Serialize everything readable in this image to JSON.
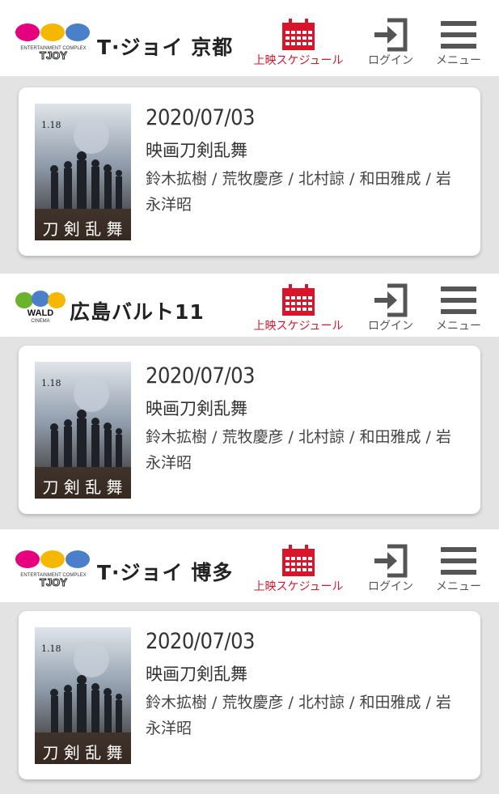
{
  "nav": {
    "schedule_label": "上映スケジュール",
    "login_label": "ログイン",
    "menu_label": "メニュー"
  },
  "brand_colors": {
    "accent_red": "#d8152b",
    "logo_pink": "#e6007e",
    "logo_yellow": "#f5b700",
    "logo_blue": "#4a7fc9"
  },
  "sections": [
    {
      "theater": "T·ジョイ 京都",
      "logo_text_top": "ENTERTAINMENT COMPLEX",
      "logo_text_main": "TJOY",
      "movie": {
        "date": "2020/07/03",
        "title": "映画刀剣乱舞",
        "cast": "鈴木拡樹 / 荒牧慶彦 / 北村諒 / 和田雅成 / 岩永洋昭"
      }
    },
    {
      "theater": "広島バルト11",
      "logo_text_top": "WALD",
      "logo_text_main": "CINEMA",
      "movie": {
        "date": "2020/07/03",
        "title": "映画刀剣乱舞",
        "cast": "鈴木拡樹 / 荒牧慶彦 / 北村諒 / 和田雅成 / 岩永洋昭"
      }
    },
    {
      "theater": "T·ジョイ 博多",
      "logo_text_top": "ENTERTAINMENT COMPLEX",
      "logo_text_main": "TJOY",
      "movie": {
        "date": "2020/07/03",
        "title": "映画刀剣乱舞",
        "cast": "鈴木拡樹 / 荒牧慶彦 / 北村諒 / 和田雅成 / 岩永洋昭"
      }
    }
  ],
  "poster": {
    "top_text": "1.18",
    "kanji": "刀 剣 乱 舞"
  }
}
